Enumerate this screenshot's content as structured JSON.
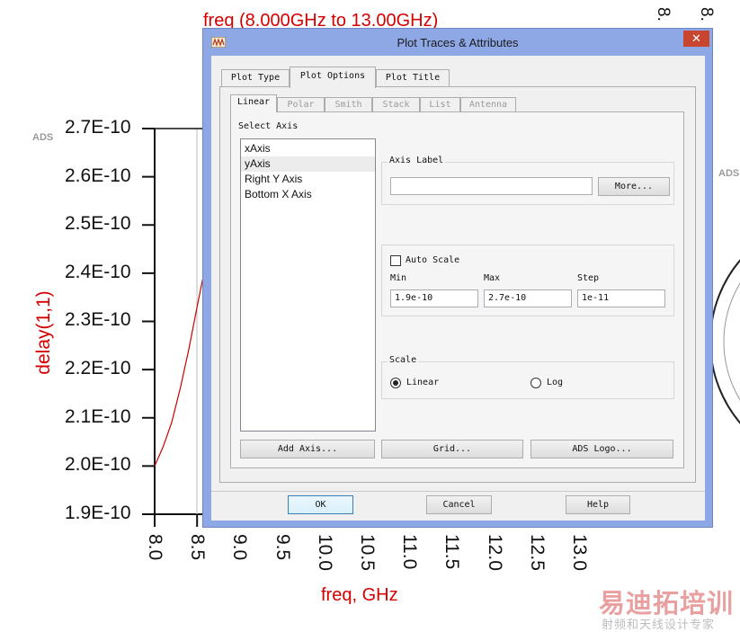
{
  "background_plot": {
    "title": "freq (8.000GHz to 13.00GHz)",
    "ads_mark_left": "ADS",
    "ads_mark_right": "ADS",
    "ylabel": "delay(1,1)",
    "xlabel": "freq, GHz",
    "yticks": [
      "2.7E-10",
      "2.6E-10",
      "2.5E-10",
      "2.4E-10",
      "2.3E-10",
      "2.2E-10",
      "2.1E-10",
      "2.0E-10",
      "1.9E-10"
    ],
    "xticks": [
      "8.0",
      "8.5",
      "9.0",
      "9.5",
      "10.0",
      "10.5",
      "11.0",
      "11.5",
      "12.0",
      "12.5",
      "13.0"
    ],
    "topright_ticks": [
      "8.",
      "8."
    ],
    "watermark_cn": "易迪拓培训",
    "watermark_sub": "射频和天线设计专家",
    "colors": {
      "trace": "#cc0000",
      "axis": "#111111"
    }
  },
  "chart_data": {
    "type": "line",
    "title": "freq (8.000GHz to 13.00GHz)",
    "xlabel": "freq, GHz",
    "ylabel": "delay(1,1)",
    "xlim": [
      8.0,
      13.0
    ],
    "ylim": [
      1.9e-10,
      2.7e-10
    ],
    "series": [
      {
        "name": "delay(1,1)",
        "x": [
          8.0,
          8.1,
          8.2,
          8.3,
          8.4,
          8.5,
          8.58
        ],
        "y": [
          2e-10,
          2.04e-10,
          2.09e-10,
          2.16e-10,
          2.24e-10,
          2.33e-10,
          2.4e-10
        ]
      }
    ]
  },
  "dialog": {
    "title": "Plot Traces & Attributes",
    "close_glyph": "✕",
    "tabs": [
      "Plot Type",
      "Plot Options",
      "Plot Title"
    ],
    "subtabs": [
      "Linear",
      "Polar",
      "Smith",
      "Stack",
      "List",
      "Antenna"
    ],
    "select_axis_label": "Select Axis",
    "axes": [
      "xAxis",
      "yAxis",
      "Right Y Axis",
      "Bottom X Axis"
    ],
    "selected_axis": "yAxis",
    "axis_label_group": "Axis Label",
    "axis_label_value": "",
    "more_button": "More...",
    "auto_scale_label": "Auto Scale",
    "auto_scale_checked": false,
    "min_label": "Min",
    "max_label": "Max",
    "step_label": "Step",
    "min_value": "1.9e-10",
    "max_value": "2.7e-10",
    "step_value": "1e-11",
    "scale_group": "Scale",
    "scale_linear": "Linear",
    "scale_log": "Log",
    "scale_selected": "Linear",
    "add_axis_button": "Add Axis...",
    "grid_button": "Grid...",
    "ads_logo_button": "ADS Logo...",
    "ok_button": "OK",
    "cancel_button": "Cancel",
    "help_button": "Help"
  }
}
